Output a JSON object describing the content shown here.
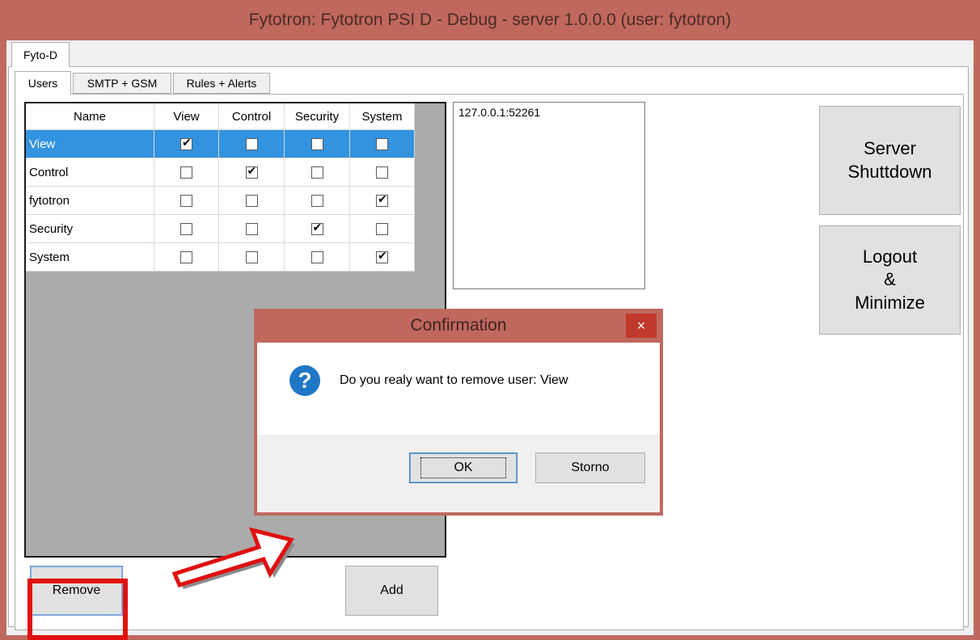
{
  "window": {
    "title": "Fytotron: Fytotron PSI D - Debug - server  1.0.0.0 (user: fytotron)"
  },
  "outer_tabs": [
    {
      "label": "Fyto-D"
    }
  ],
  "inner_tabs": [
    {
      "label": "Users"
    },
    {
      "label": "SMTP + GSM"
    },
    {
      "label": "Rules + Alerts"
    }
  ],
  "users_grid": {
    "columns": [
      "Name",
      "View",
      "Control",
      "Security",
      "System"
    ],
    "rows": [
      {
        "name": "View",
        "view": true,
        "control": false,
        "security": false,
        "system": false,
        "selected": true
      },
      {
        "name": "Control",
        "view": false,
        "control": true,
        "security": false,
        "system": false,
        "selected": false
      },
      {
        "name": "fytotron",
        "view": false,
        "control": false,
        "security": false,
        "system": true,
        "selected": false
      },
      {
        "name": "Security",
        "view": false,
        "control": false,
        "security": true,
        "system": false,
        "selected": false
      },
      {
        "name": "System",
        "view": false,
        "control": false,
        "security": false,
        "system": true,
        "selected": false
      }
    ]
  },
  "connections": {
    "items": [
      "127.0.0.1:52261"
    ]
  },
  "buttons": {
    "server_shutdown_line1": "Server",
    "server_shutdown_line2": "Shuttdown",
    "logout_line1": "Logout",
    "logout_line2": "&",
    "logout_line3": "Minimize",
    "remove": "Remove",
    "add": "Add"
  },
  "dialog": {
    "title": "Confirmation",
    "close_glyph": "×",
    "message": "Do you realy want to remove user: View",
    "icon_glyph": "?",
    "ok": "OK",
    "cancel": "Storno"
  },
  "colors": {
    "title_bar": "#c0685e",
    "selection": "#3393df",
    "annotation_red": "#e01010"
  }
}
